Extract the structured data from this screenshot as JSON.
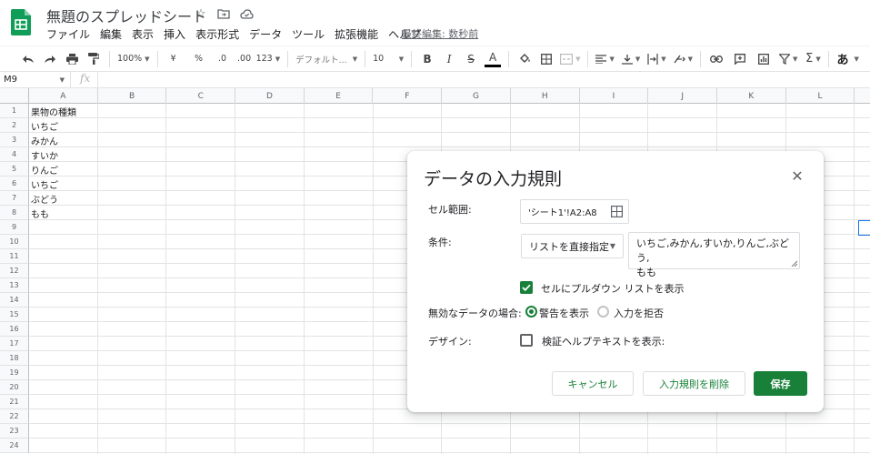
{
  "app": {
    "doc_title": "無題のスプレッドシート",
    "last_edit": "最終編集: 数秒前",
    "brand_color": "#0f9d58",
    "accent_color": "#188038"
  },
  "menu": [
    "ファイル",
    "編集",
    "表示",
    "挿入",
    "表示形式",
    "データ",
    "ツール",
    "拡張機能",
    "ヘルプ"
  ],
  "toolbar": {
    "zoom": "100%",
    "currency": "¥",
    "percent": "%",
    "dec_decrease": ".0",
    "dec_increase": ".00",
    "format_more": "123",
    "font": "デフォルト...",
    "font_size": "10",
    "bold": "B",
    "italic": "I",
    "strike": "S",
    "text_color": "A",
    "input_tools": "あ"
  },
  "formula_bar": {
    "name_box": "M9",
    "fx": "fx"
  },
  "sheet": {
    "columns": [
      "A",
      "B",
      "C",
      "D",
      "E",
      "F",
      "G",
      "H",
      "I",
      "J",
      "K",
      "L"
    ],
    "rows": [
      "1",
      "2",
      "3",
      "4",
      "5",
      "6",
      "7",
      "8",
      "9",
      "10",
      "11",
      "12",
      "13",
      "14",
      "15",
      "16",
      "17",
      "18",
      "19",
      "20",
      "21",
      "22",
      "23",
      "24"
    ],
    "cells_a": [
      "果物の種類",
      "いちご",
      "みかん",
      "すいか",
      "りんご",
      "いちご",
      "ぶどう",
      "もも"
    ]
  },
  "dialog": {
    "title": "データの入力規則",
    "close_icon": "close-icon",
    "cell_range_label": "セル範囲:",
    "cell_range_value": "'シート1'!A2:A8",
    "criteria_label": "条件:",
    "criteria_type": "リストを直接指定",
    "list_line1": "いちご,みかん,すいか,りんご,ぶどう,",
    "list_line2": "もも",
    "show_dropdown_label": "セルにプルダウン リストを表示",
    "invalid_label": "無効なデータの場合:",
    "warn_label": "警告を表示",
    "reject_label": "入力を拒否",
    "appearance_label": "デザイン:",
    "help_text_label": "検証ヘルプテキストを表示:",
    "cancel_label": "キャンセル",
    "remove_label": "入力規則を削除",
    "save_label": "保存"
  }
}
